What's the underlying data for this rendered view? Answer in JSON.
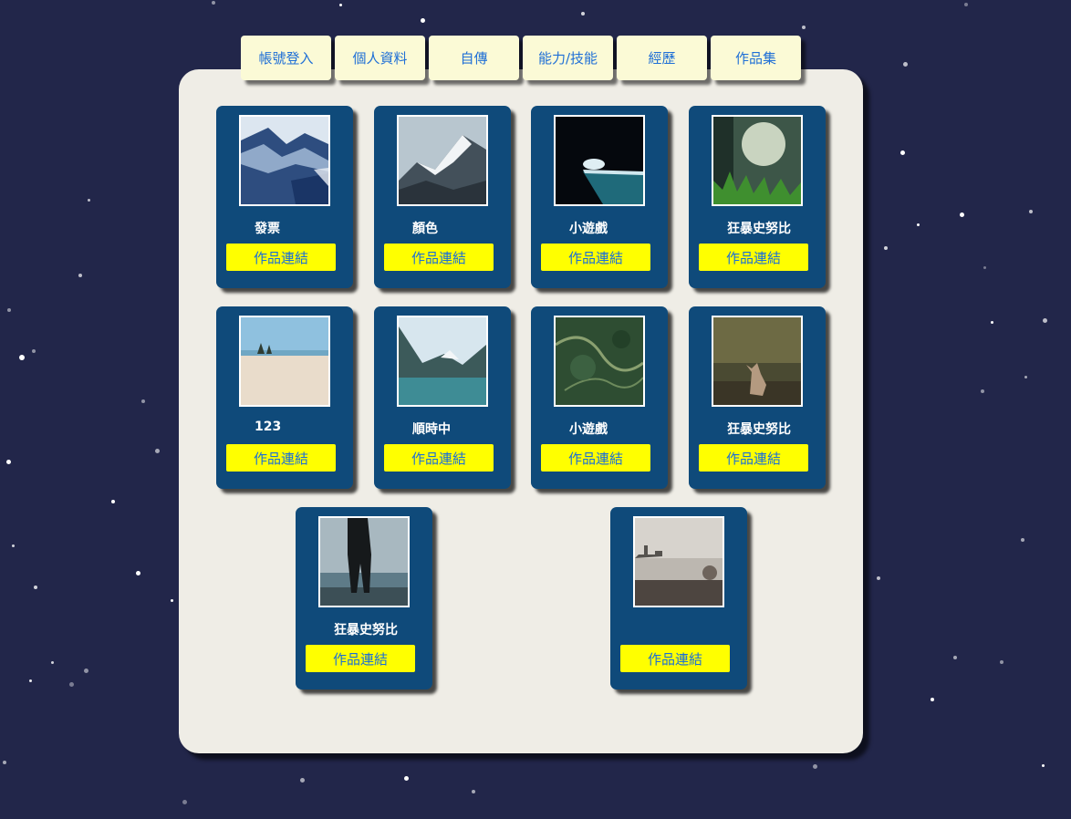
{
  "nav": {
    "tabs": [
      {
        "label": "帳號登入"
      },
      {
        "label": "個人資料"
      },
      {
        "label": "自傳"
      },
      {
        "label": "能力/技能"
      },
      {
        "label": "經歷"
      },
      {
        "label": "作品集"
      }
    ]
  },
  "portfolio": {
    "link_label": "作品連結",
    "items": [
      {
        "title": "發票",
        "image": "mountain-snow-abstract"
      },
      {
        "title": "顏色",
        "image": "snowy-mountain-ridge"
      },
      {
        "title": "小遊戲",
        "image": "dark-pool-splash"
      },
      {
        "title": "狂暴史努比",
        "image": "grass-sunlight"
      },
      {
        "title": "123",
        "image": "sandy-beach"
      },
      {
        "title": "順時中",
        "image": "mountain-lake"
      },
      {
        "title": "小遊戲",
        "image": "aerial-forest-river"
      },
      {
        "title": "狂暴史努比",
        "image": "fox-in-forest"
      },
      {
        "title": "狂暴史努比",
        "image": "person-at-waterfall"
      },
      {
        "title": "",
        "image": "city-skyline-shore"
      }
    ]
  },
  "colors": {
    "background": "#22264a",
    "panel": "#efede6",
    "card": "#0f4a7a",
    "tab": "#fbfad6",
    "tab_text": "#1f6fd6",
    "button": "#ffff00",
    "button_text": "#1a6ed8"
  }
}
